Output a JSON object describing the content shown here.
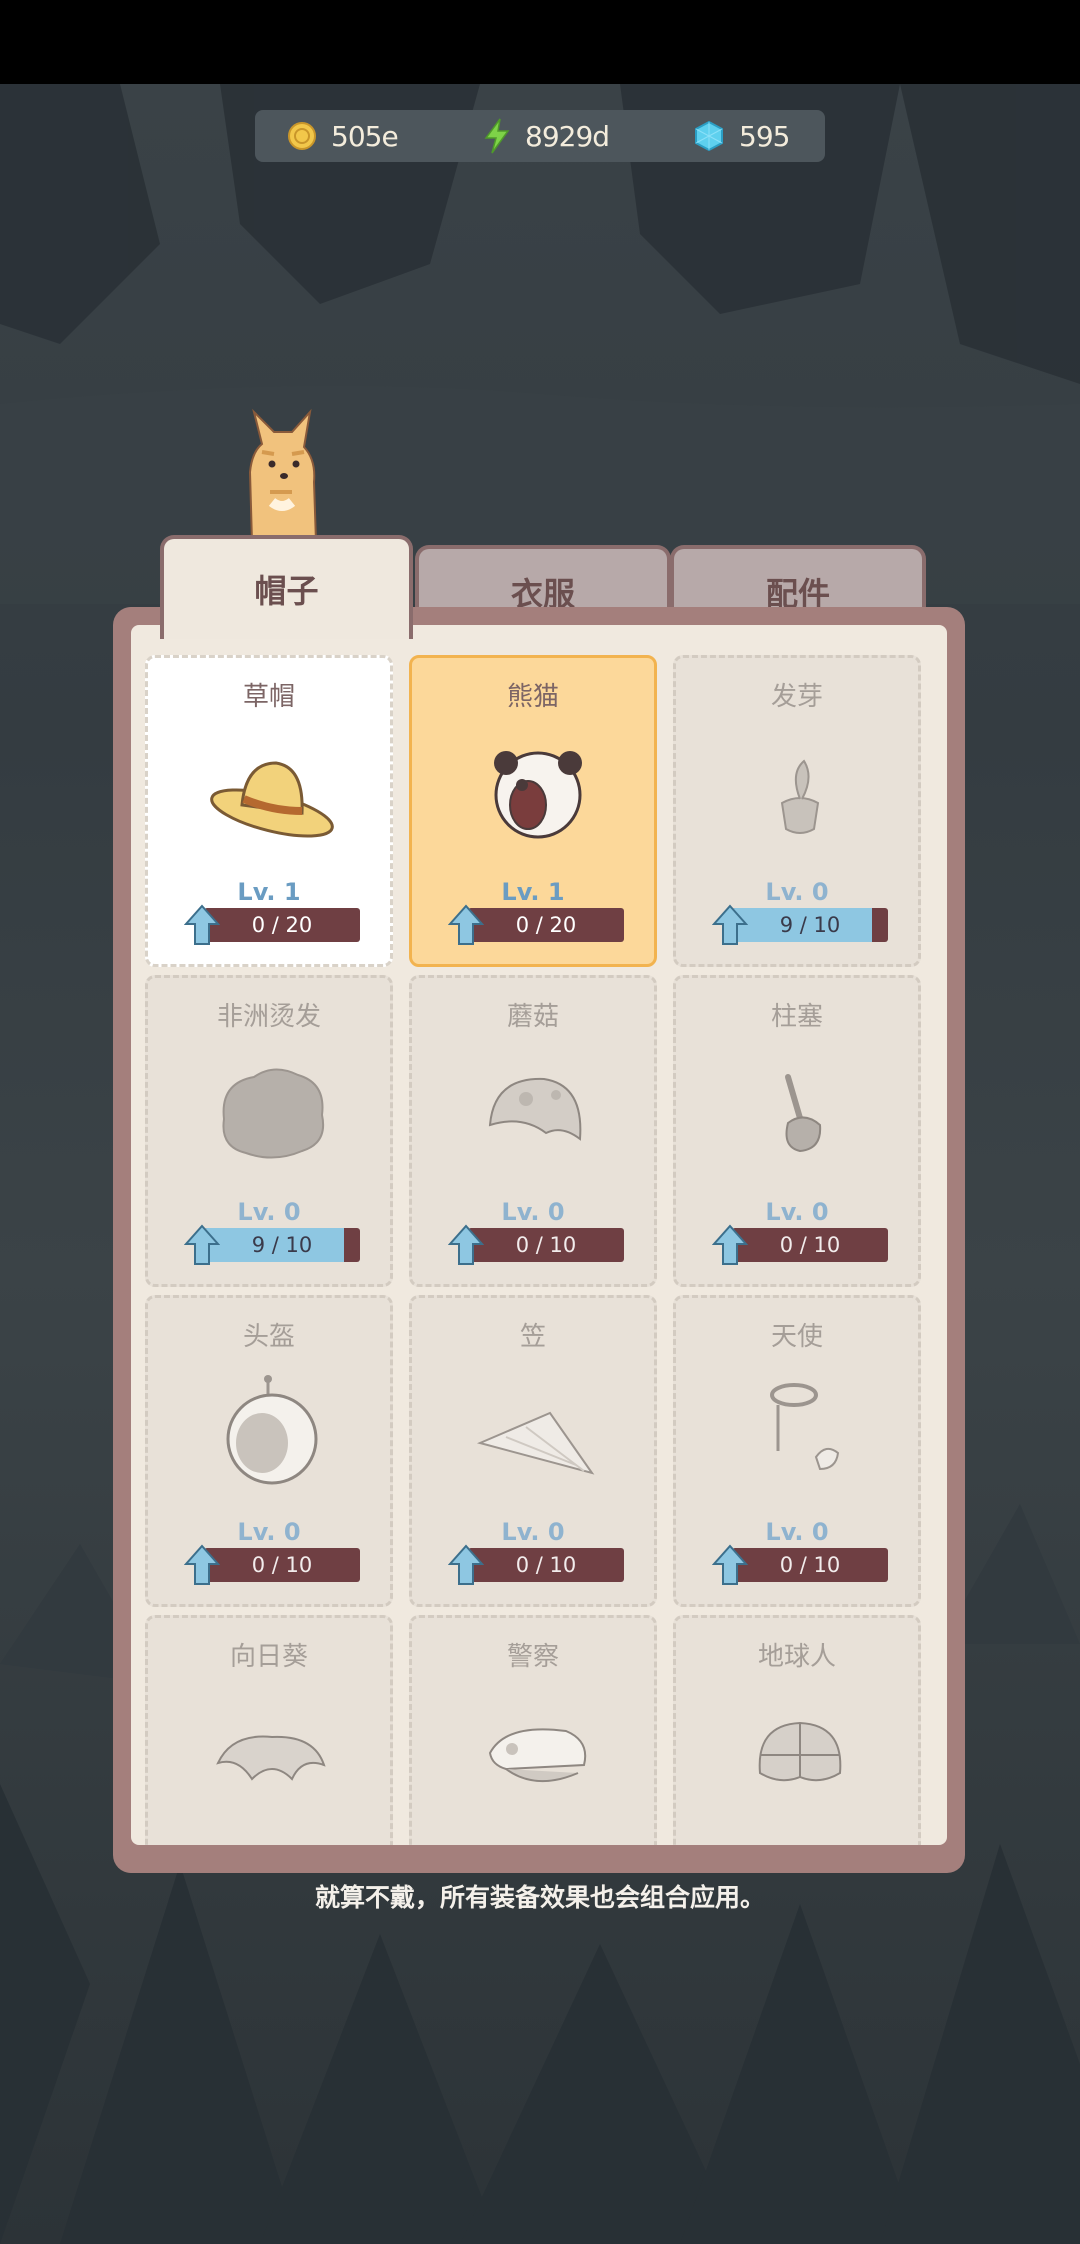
{
  "currency": {
    "coins": "505e",
    "energy": "8929d",
    "gems": "595"
  },
  "tabs": [
    {
      "label": "帽子",
      "active": true
    },
    {
      "label": "衣服",
      "active": false
    },
    {
      "label": "配件",
      "active": false
    }
  ],
  "items": [
    {
      "name": "草帽",
      "level": "Lv. 1",
      "progress": "0 / 20",
      "state": "owned",
      "icon": "straw-hat-icon",
      "fill_fraction": 0
    },
    {
      "name": "熊猫",
      "level": "Lv. 1",
      "progress": "0 / 20",
      "state": "selected",
      "icon": "panda-hat-icon",
      "fill_fraction": 0
    },
    {
      "name": "发芽",
      "level": "Lv. 0",
      "progress": "9 / 10",
      "state": "locked",
      "icon": "sprout-icon",
      "fill_fraction": 0.9
    },
    {
      "name": "非洲烫发",
      "level": "Lv. 0",
      "progress": "9 / 10",
      "state": "locked",
      "icon": "afro-icon",
      "fill_fraction": 0.9
    },
    {
      "name": "蘑菇",
      "level": "Lv. 0",
      "progress": "0 / 10",
      "state": "locked",
      "icon": "mushroom-icon",
      "fill_fraction": 0
    },
    {
      "name": "柱塞",
      "level": "Lv. 0",
      "progress": "0 / 10",
      "state": "locked",
      "icon": "plunger-icon",
      "fill_fraction": 0
    },
    {
      "name": "头盔",
      "level": "Lv. 0",
      "progress": "0 / 10",
      "state": "locked",
      "icon": "space-helmet-icon",
      "fill_fraction": 0
    },
    {
      "name": "笠",
      "level": "Lv. 0",
      "progress": "0 / 10",
      "state": "locked",
      "icon": "conical-hat-icon",
      "fill_fraction": 0
    },
    {
      "name": "天使",
      "level": "Lv. 0",
      "progress": "0 / 10",
      "state": "locked",
      "icon": "halo-icon",
      "fill_fraction": 0
    },
    {
      "name": "向日葵",
      "level": "",
      "progress": "",
      "state": "locked",
      "icon": "sunflower-icon",
      "fill_fraction": 0
    },
    {
      "name": "警察",
      "level": "",
      "progress": "",
      "state": "locked",
      "icon": "police-cap-icon",
      "fill_fraction": 0
    },
    {
      "name": "地球人",
      "level": "",
      "progress": "",
      "state": "locked",
      "icon": "earthling-helmet-icon",
      "fill_fraction": 0
    }
  ],
  "hint": "就算不戴，所有装备效果也会组合应用。",
  "colors": {
    "panel": "#a47f7c",
    "selected": "#fcd89a",
    "progress_track": "#6f3f43",
    "progress_fill": "#8ec7e2"
  }
}
